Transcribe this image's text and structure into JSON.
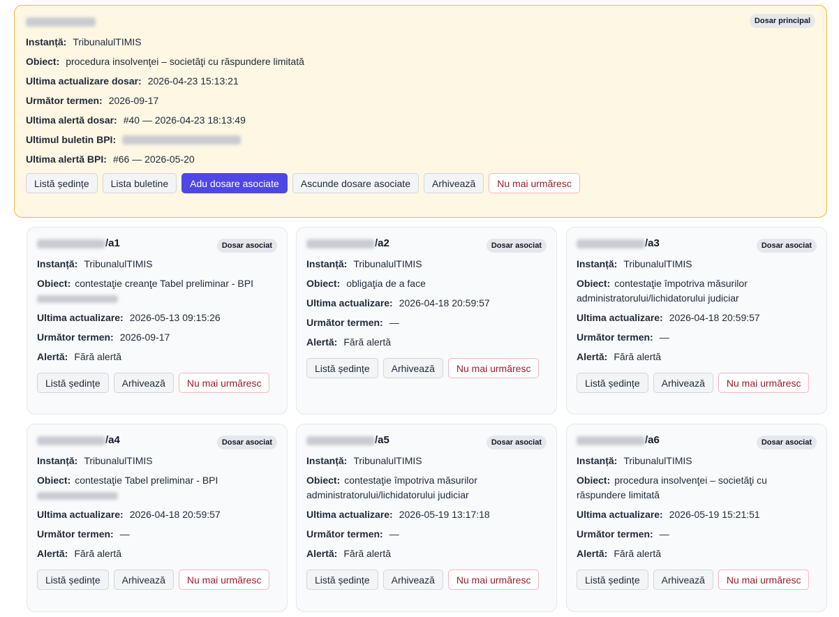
{
  "main": {
    "badge": "Dosar principal",
    "fields": [
      {
        "label": "Instanță:",
        "value": "TribunalulTIMIS"
      },
      {
        "label": "Obiect:",
        "value": "procedura insolvenţei – societăţi cu răspundere limitată"
      },
      {
        "label": "Ultima actualizare dosar:",
        "value": "2026-04-23 15:13:21"
      },
      {
        "label": "Următor termen:",
        "value": "2026-09-17"
      },
      {
        "label": "Ultima alertă dosar:",
        "value": "#40 — 2026-04-23 18:13:49"
      },
      {
        "label": "Ultimul buletin BPI:",
        "value": ""
      },
      {
        "label": "Ultima alertă BPI:",
        "value": "#66 — 2026-05-20"
      }
    ],
    "buttons": {
      "sessions": "Listă ședințe",
      "bulletins": "Lista buletine",
      "add_assoc": "Adu dosare asociate",
      "hide_assoc": "Ascunde dosare asociate",
      "archive": "Arhivează",
      "unfollow": "Nu mai urmăresc"
    }
  },
  "labels": {
    "instanta": "Instanță:",
    "obiect": "Obiect:",
    "ultima": "Ultima actualizare:",
    "termen": "Următor termen:",
    "alerta": "Alertă:",
    "badge": "Dosar asociat",
    "sessions": "Listă ședințe",
    "archive": "Arhivează",
    "unfollow": "Nu mai urmăresc"
  },
  "assoc": [
    {
      "suffix": "/a1",
      "instanta": "TribunalulTIMIS",
      "obiect": "contestaţie creanţe Tabel preliminar - BPI",
      "ultima": "2026-05-13 09:15:26",
      "termen": "2026-09-17",
      "alerta": "Fără alertă"
    },
    {
      "suffix": "/a2",
      "instanta": "TribunalulTIMIS",
      "obiect": "obligaţia de a face",
      "ultima": "2026-04-18 20:59:57",
      "termen": "—",
      "alerta": "Fără alertă"
    },
    {
      "suffix": "/a3",
      "instanta": "TribunalulTIMIS",
      "obiect": "contestaţie împotriva măsurilor administratorului/lichidatorului judiciar",
      "ultima": "2026-04-18 20:59:57",
      "termen": "—",
      "alerta": "Fără alertă"
    },
    {
      "suffix": "/a4",
      "instanta": "TribunalulTIMIS",
      "obiect": "contestaţie Tabel preliminar - BPI",
      "ultima": "2026-04-18 20:59:57",
      "termen": "—",
      "alerta": "Fără alertă"
    },
    {
      "suffix": "/a5",
      "instanta": "TribunalulTIMIS",
      "obiect": "contestaţie împotriva măsurilor administratorului/lichidatorului judiciar",
      "ultima": "2026-05-19 13:17:18",
      "termen": "—",
      "alerta": "Fără alertă"
    },
    {
      "suffix": "/a6",
      "instanta": "TribunalulTIMIS",
      "obiect": "procedura insolvenţei – societăţi cu răspundere limitată",
      "ultima": "2026-05-19 15:21:51",
      "termen": "—",
      "alerta": "Fără alertă"
    }
  ]
}
